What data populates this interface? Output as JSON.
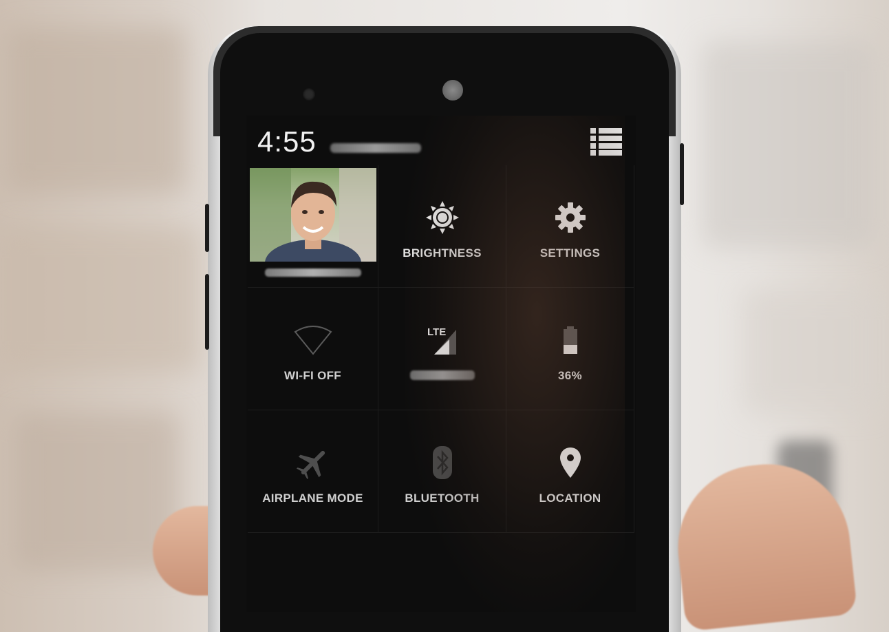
{
  "status_bar": {
    "time": "4:55",
    "menu_icon": "list-view-icon"
  },
  "quick_settings": {
    "tiles": [
      {
        "id": "user",
        "label": "",
        "icon": "user-avatar"
      },
      {
        "id": "brightness",
        "label": "BRIGHTNESS",
        "icon": "brightness-icon"
      },
      {
        "id": "settings",
        "label": "SETTINGS",
        "icon": "gear-icon"
      },
      {
        "id": "wifi",
        "label": "WI-FI OFF",
        "icon": "wifi-off-icon"
      },
      {
        "id": "mobile",
        "label": "",
        "icon": "lte-signal-icon",
        "icon_text": "LTE"
      },
      {
        "id": "battery",
        "label": "36%",
        "icon": "battery-icon",
        "level": 0.36
      },
      {
        "id": "airplane",
        "label": "AIRPLANE MODE",
        "icon": "airplane-icon"
      },
      {
        "id": "bluetooth",
        "label": "BLUETOOTH",
        "icon": "bluetooth-icon"
      },
      {
        "id": "location",
        "label": "LOCATION",
        "icon": "location-pin-icon"
      }
    ]
  },
  "colors": {
    "screen_bg": "#0d0d0d",
    "text": "#e6e6e6",
    "dim_icon": "#5a5a5a"
  }
}
